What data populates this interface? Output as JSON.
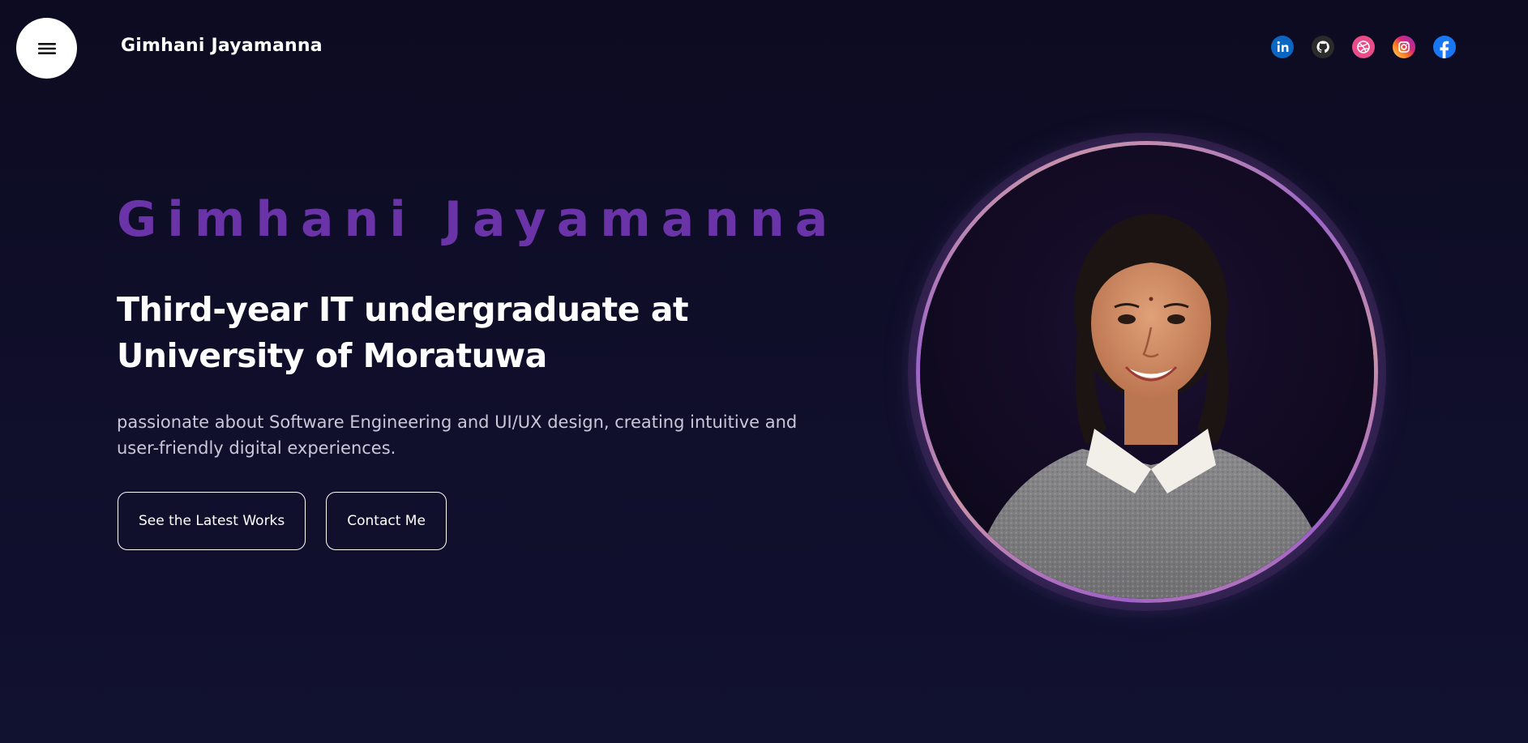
{
  "header": {
    "brand": "Gimhani Jayamanna",
    "menu_icon": "hamburger-menu-icon",
    "socials": [
      {
        "name": "linkedin",
        "icon": "linkedin-icon",
        "color": "#0a66c2"
      },
      {
        "name": "github",
        "icon": "github-icon",
        "color": "#333333"
      },
      {
        "name": "dribbble",
        "icon": "dribbble-icon",
        "color": "#ea4c89"
      },
      {
        "name": "instagram",
        "icon": "instagram-icon",
        "color": "#d62976"
      },
      {
        "name": "facebook",
        "icon": "facebook-icon",
        "color": "#1877f2"
      }
    ]
  },
  "hero": {
    "name": "Gimhani Jayamanna",
    "title_line1": "Third-year IT undergraduate at",
    "title_line2": "University of Moratuwa",
    "description": "passionate about Software Engineering and UI/UX design, creating intuitive and user-friendly digital experiences.",
    "buttons": {
      "works_label": "See the Latest Works",
      "contact_label": "Contact Me"
    },
    "accent_color": "#6a34a8"
  },
  "portrait": {
    "icon": "profile-photo"
  }
}
